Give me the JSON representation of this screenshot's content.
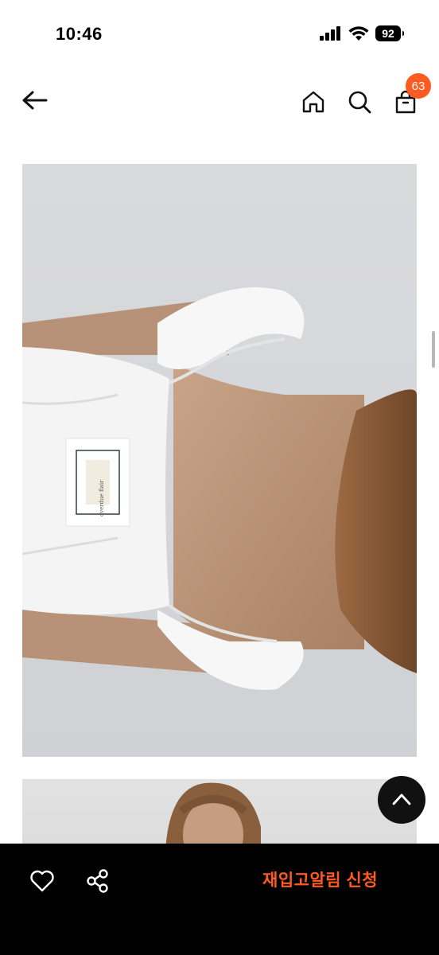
{
  "status_bar": {
    "time": "10:46",
    "battery": "92"
  },
  "nav": {
    "cart_count": "63"
  },
  "product": {
    "label_text": "overdue flair"
  },
  "bottom_bar": {
    "restock_label": "재입고알림 신청"
  },
  "colors": {
    "accent": "#ff5a1f",
    "bottom_bar": "#000000"
  },
  "icons": [
    "back-arrow-icon",
    "home-icon",
    "search-icon",
    "shopping-bag-icon",
    "heart-icon",
    "share-icon",
    "chevron-up-icon"
  ]
}
